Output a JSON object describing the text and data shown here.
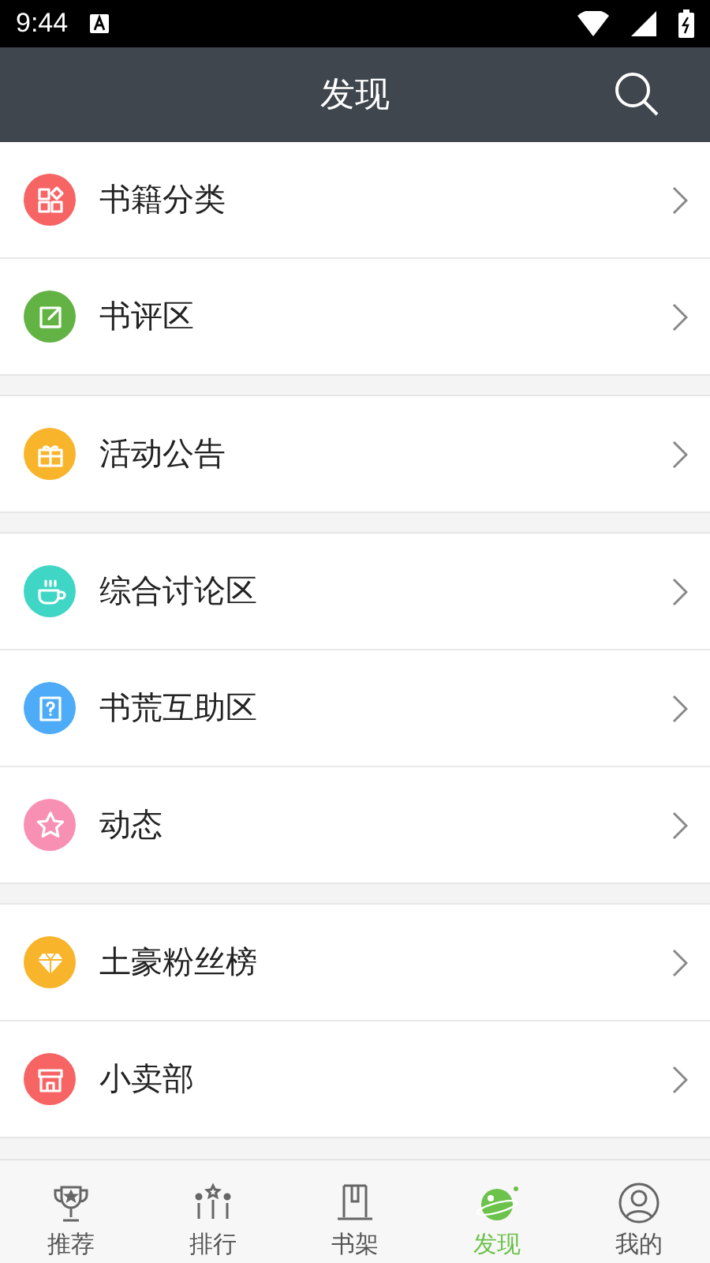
{
  "status_bar": {
    "time": "9:44"
  },
  "header": {
    "title": "发现"
  },
  "groups": [
    {
      "items": [
        {
          "label": "书籍分类",
          "kind": "shapes",
          "color": "#f76464"
        },
        {
          "label": "书评区",
          "kind": "edit",
          "color": "#63b344"
        }
      ]
    },
    {
      "items": [
        {
          "label": "活动公告",
          "kind": "gift",
          "color": "#f8b42a"
        }
      ]
    },
    {
      "items": [
        {
          "label": "综合讨论区",
          "kind": "cup",
          "color": "#3fd6c6"
        },
        {
          "label": "书荒互助区",
          "kind": "question",
          "color": "#4dabf7"
        },
        {
          "label": "动态",
          "kind": "star",
          "color": "#f890b4"
        }
      ]
    },
    {
      "items": [
        {
          "label": "土豪粉丝榜",
          "kind": "diamond",
          "color": "#f8b42a"
        },
        {
          "label": "小卖部",
          "kind": "shop",
          "color": "#f76464"
        }
      ]
    }
  ],
  "tabs": [
    {
      "label": "推荐",
      "kind": "trophy",
      "selected": false
    },
    {
      "label": "排行",
      "kind": "rank",
      "selected": false
    },
    {
      "label": "书架",
      "kind": "shelf",
      "selected": false
    },
    {
      "label": "发现",
      "kind": "planet",
      "selected": true
    },
    {
      "label": "我的",
      "kind": "user",
      "selected": false
    }
  ]
}
